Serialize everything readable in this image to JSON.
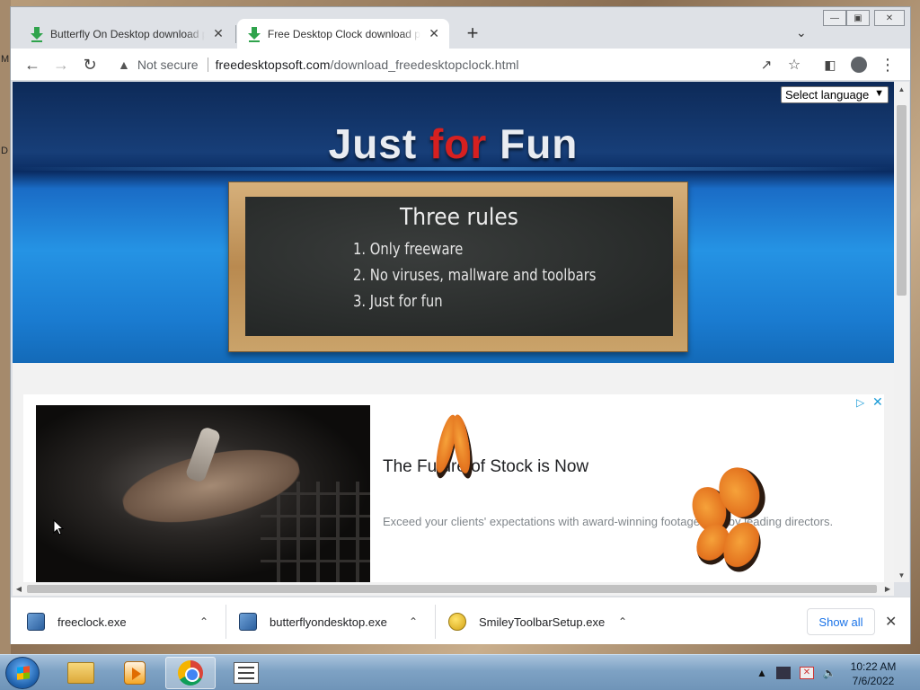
{
  "browser": {
    "tabs": [
      {
        "title": "Butterfly On Desktop download page",
        "active": false
      },
      {
        "title": "Free Desktop Clock download page",
        "active": true
      }
    ],
    "security_label": "Not secure",
    "url_host": "freedesktopsoft.com",
    "url_path": "/download_freedesktopclock.html"
  },
  "page": {
    "language_select": "Select language",
    "hero_title_part1": "Just ",
    "hero_title_part2": "for",
    "hero_title_part3": " Fun",
    "board_title": "Three rules",
    "rules": [
      "1. Only freeware",
      "2. No viruses, mallware and toolbars",
      "3. Just for fun"
    ],
    "ad": {
      "headline": "The Future of Stock is Now",
      "body": "Exceed your clients' expectations with award-winning footage shot by leading directors."
    }
  },
  "downloads": {
    "items": [
      "freeclock.exe",
      "butterflyondesktop.exe",
      "SmileyToolbarSetup.exe"
    ],
    "show_all": "Show all"
  },
  "taskbar": {
    "time": "10:22 AM",
    "date": "7/6/2022"
  },
  "desktop": {
    "glyph_top": "M",
    "glyph_bottom": "D"
  }
}
